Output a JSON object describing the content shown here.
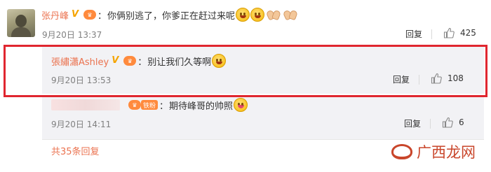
{
  "comment": {
    "author": "张丹峰",
    "text": "你俩别逃了，你爹正在赶过来呢",
    "date": "9月20日 13:37",
    "reply_label": "回复",
    "like_count": "425"
  },
  "replies": [
    {
      "author": "張繡瀟Ashley",
      "text": "别让我们久等啊",
      "date": "9月20日 13:53",
      "reply_label": "回复",
      "like_count": "108"
    },
    {
      "author": "",
      "badge": "铁粉",
      "text": "期待峰哥的帅照",
      "date": "9月20日 14:11",
      "reply_label": "回复",
      "like_count": "6"
    }
  ],
  "more_replies_link": "共35条回复",
  "watermark": "广西龙网",
  "colors": {
    "username": "#eb7350",
    "highlight_border": "#e0262f",
    "badge_orange": "#ff8a3d",
    "watermark": "#c9462b"
  },
  "icons": [
    "verified-v-icon",
    "vip-icon",
    "smile-emoji-icon",
    "clap-emoji-icon",
    "like-thumb-icon",
    "fan-badge-icon",
    "tongue-emoji-icon"
  ]
}
